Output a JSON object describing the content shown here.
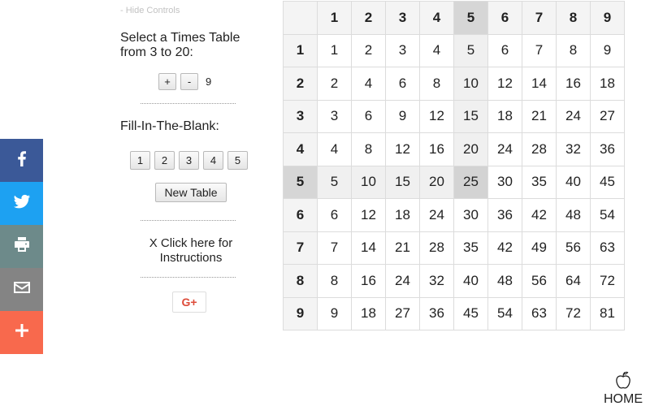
{
  "share": {
    "buttons": [
      {
        "name": "facebook",
        "icon": "facebook-icon",
        "color": "#3b5998"
      },
      {
        "name": "twitter",
        "icon": "twitter-icon",
        "color": "#1da1f2"
      },
      {
        "name": "print",
        "icon": "print-icon",
        "color": "#6d8a8a"
      },
      {
        "name": "email",
        "icon": "email-icon",
        "color": "#848484"
      },
      {
        "name": "more",
        "icon": "plus-icon",
        "color": "#f8694d"
      }
    ]
  },
  "controls": {
    "hide_label": "- Hide Controls",
    "select_label": "Select a Times Table from 3 to 20:",
    "plus_label": "+",
    "minus_label": "-",
    "table_value": "9",
    "fill_label": "Fill-In-The-Blank:",
    "blank_buttons": [
      "1",
      "2",
      "3",
      "4",
      "5"
    ],
    "new_table_label": "New Table",
    "instructions_label": "X Click here for Instructions",
    "gplus_label": "G+"
  },
  "table": {
    "size": 9,
    "highlight": 5,
    "header_bg": "#f4f4f4",
    "highlight_bg": "#d6d6d6"
  },
  "home": {
    "label": "HOME",
    "icon": "apple-icon"
  }
}
